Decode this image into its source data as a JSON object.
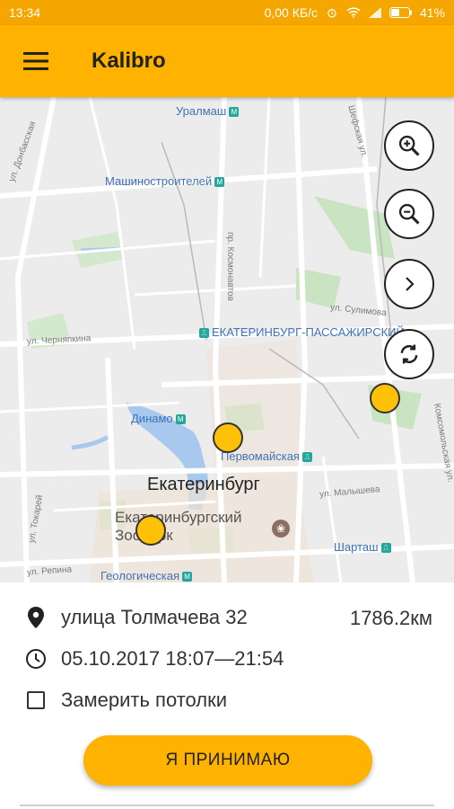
{
  "status_bar": {
    "time": "13:34",
    "speed": "0,00 КБ/с",
    "battery": "41%"
  },
  "app_bar": {
    "menu_icon": "hamburger-icon",
    "title": "Kalibro"
  },
  "map": {
    "labels": {
      "uralmash": "Уралмаш",
      "mashinostroiteley": "Машиностроителей",
      "station": "ЕКАТЕРИНБУРГ-ПАССАЖИРСКИЙ",
      "dinamo": "Динамо",
      "pervomayskaya": "Первомайская",
      "city": "Екатеринбург",
      "zoo": "Екатеринбургский Зоопарк",
      "shartash": "Шарташ",
      "geologicheskaya": "Геологическая",
      "kosmonavtov": "пр. Космонавтов",
      "sulimova": "ул. Сулимова",
      "cheryapkina": "ул. Черняпкина",
      "malysheva": "ул. Малышева",
      "tokarey": "ул. Токарей",
      "repina": "ул. Репина",
      "donbasskaya": "ул. Донбасская",
      "shefskaya": "Шефская ул.",
      "komsomolskaya": "Комсомольская ул."
    },
    "controls": [
      "zoom-in-icon",
      "zoom-out-icon",
      "chevron-right-icon",
      "refresh-icon"
    ]
  },
  "order": {
    "address": "улица Толмачева 32",
    "distance": "1786.2км",
    "datetime": "05.10.2017 18:07—21:54",
    "measure_ceilings_label": "Замерить потолки",
    "measure_ceilings_checked": false,
    "accept_label": "Я ПРИНИМАЮ"
  },
  "colors": {
    "accent": "#ffb300",
    "status_bar": "#f6a600",
    "marker": "#ffc107"
  }
}
